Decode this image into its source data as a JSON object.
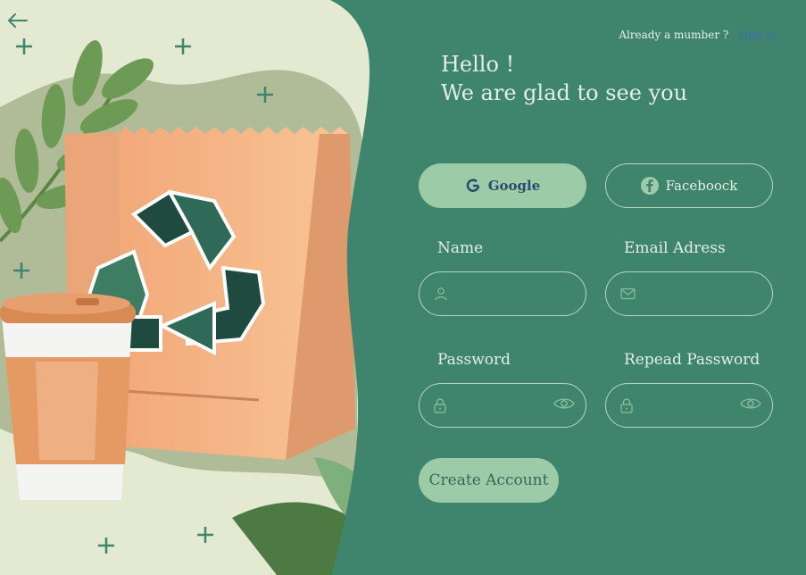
{
  "header": {
    "already_text": "Already a mumber ?",
    "sign_in": "Sign in"
  },
  "greeting": {
    "line1": "Hello !",
    "line2": "We are glad to see you"
  },
  "social": {
    "google_label": "Google",
    "facebook_label": "Faceboock"
  },
  "form": {
    "name_label": "Name",
    "email_label": "Email Adress",
    "password_label": "Password",
    "repeat_label": "Repead Password",
    "name_value": "",
    "email_value": "",
    "password_value": "",
    "repeat_value": ""
  },
  "actions": {
    "create_label": "Create Account"
  },
  "icons": {
    "back": "arrow-left-icon",
    "user": "user-icon",
    "mail": "mail-icon",
    "lock": "lock-icon",
    "eye": "eye-icon"
  },
  "colors": {
    "panel": "#3f846c",
    "accent_button": "#9ccba8",
    "background_left": "#e4e9d2"
  }
}
